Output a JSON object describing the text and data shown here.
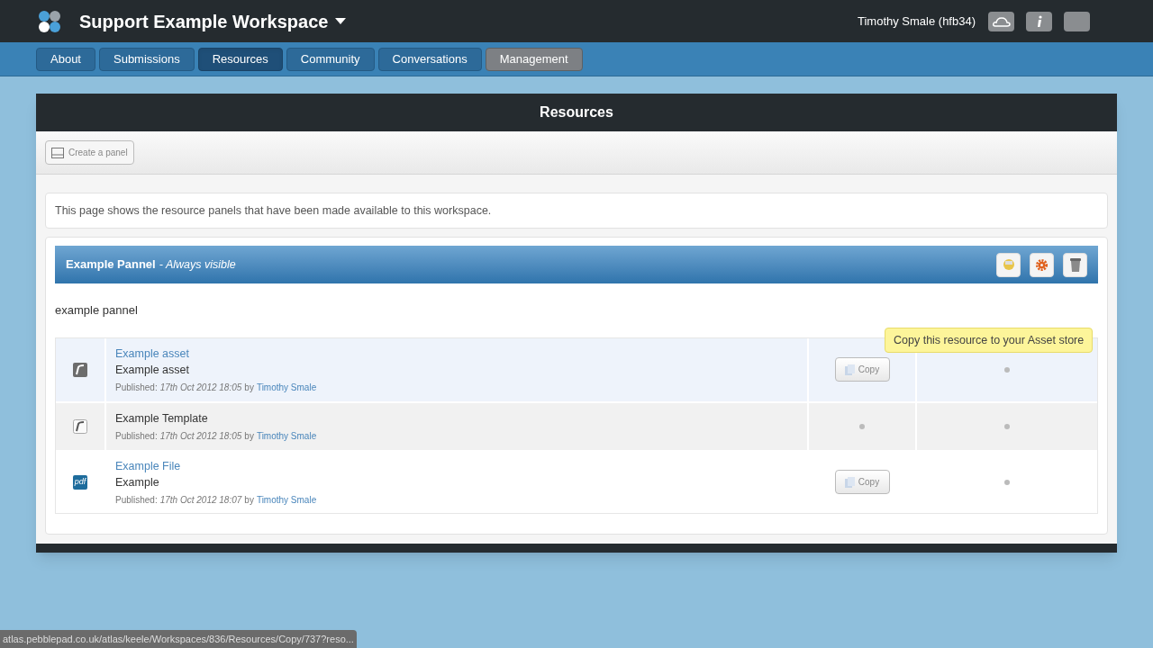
{
  "header": {
    "workspace_title": "Support Example Workspace",
    "user_name": "Timothy Smale (hfb34)"
  },
  "nav_tabs": [
    {
      "label": "About",
      "selected": false,
      "kind": "section"
    },
    {
      "label": "Submissions",
      "selected": false,
      "kind": "section"
    },
    {
      "label": "Resources",
      "selected": true,
      "kind": "section"
    },
    {
      "label": "Community",
      "selected": false,
      "kind": "section"
    },
    {
      "label": "Conversations",
      "selected": false,
      "kind": "section"
    },
    {
      "label": "Management",
      "selected": false,
      "kind": "admin"
    }
  ],
  "page_title": "Resources",
  "toolbar": {
    "create_button": "Create a panel"
  },
  "intro": "This page shows the resource panels that have been made available to this workspace.",
  "panel": {
    "title": "Example Pannel",
    "visibility": "- Always visible",
    "description": "example pannel",
    "resources": [
      {
        "kind": "asset",
        "title": "Example asset",
        "linked": true,
        "subtitle": "Example asset",
        "published_label": "Published:",
        "date": "17th Oct 2012 18:05",
        "by": "by",
        "author": "Timothy Smale",
        "copy_button": "Copy",
        "highlighted": true
      },
      {
        "kind": "template",
        "title": "Example Template",
        "linked": false,
        "published_label": "Published:",
        "date": "17th Oct 2012 18:05",
        "by": "by",
        "author": "Timothy Smale",
        "highlighted": false
      },
      {
        "kind": "file",
        "icon_text": "pdf",
        "title": "Example File",
        "linked": true,
        "subtitle": "Example",
        "published_label": "Published:",
        "date": "17th Oct 2012 18:07",
        "by": "by",
        "author": "Timothy Smale",
        "copy_button": "Copy",
        "highlighted": false
      }
    ]
  },
  "tooltip": "Copy this resource to your Asset store",
  "status_url": "atlas.pebblepad.co.uk/atlas/keele/Workspaces/836/Resources/Copy/737?reso..."
}
